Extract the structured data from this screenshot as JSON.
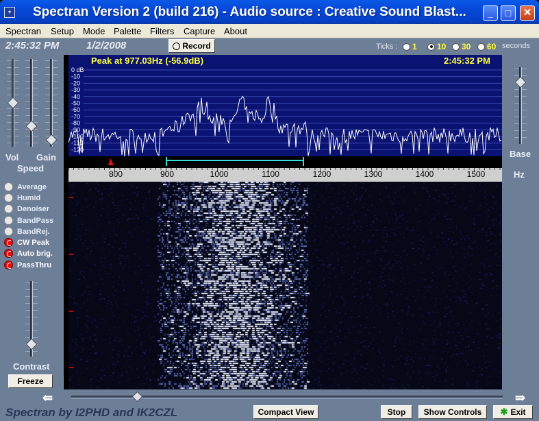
{
  "window": {
    "title": "Spectran Version 2 (build 216) - Audio source  :  Creative Sound Blast...",
    "controls": {
      "minimize": "_",
      "maximize": "□",
      "close": "✕"
    }
  },
  "menu": [
    "Spectran",
    "Setup",
    "Mode",
    "Palette",
    "Filters",
    "Capture",
    "About"
  ],
  "status": {
    "time": "2:45:32 PM",
    "date": "1/2/2008"
  },
  "record_label": "Record",
  "ticks": {
    "label": "Ticks :",
    "options": [
      "1",
      "10",
      "30",
      "60"
    ],
    "selected": "10",
    "unit": "seconds"
  },
  "sliders": {
    "vol": "Vol",
    "gain": "Gain",
    "speed": "Speed",
    "contrast": "Contrast",
    "base": "Base",
    "hz": "Hz"
  },
  "scope": {
    "peak_text": "Peak at   977.03Hz (-56.9dB)",
    "clock": "2:45:32 PM",
    "db_labels": [
      "0 dB",
      "-10",
      "-20",
      "-30",
      "-40",
      "-50",
      "-60",
      "-70",
      "-80",
      "-90",
      "-100",
      "-110",
      "-120"
    ]
  },
  "freq_axis": {
    "labels": [
      "800",
      "900",
      "1000",
      "1100",
      "1200",
      "1300",
      "1400",
      "1500"
    ]
  },
  "options": [
    {
      "label": "Average",
      "on": false
    },
    {
      "label": "Humid",
      "on": false
    },
    {
      "label": "Denoiser",
      "on": false
    },
    {
      "label": "BandPass",
      "on": false
    },
    {
      "label": "BandRej.",
      "on": false
    },
    {
      "label": "CW Peak",
      "on": true
    },
    {
      "label": "Auto brig.",
      "on": true
    },
    {
      "label": "PassThru",
      "on": true
    }
  ],
  "buttons": {
    "freeze": "Freeze",
    "compact": "Compact View",
    "stop": "Stop",
    "show_controls": "Show Controls",
    "exit": "Exit"
  },
  "footer": "Spectran  by I2PHD and IK2CZL",
  "colors": {
    "title_bar": "#0648d8",
    "scope_bg": "#0a1272",
    "waterfall_bg": "#060818",
    "body_bg": "#6d7e97",
    "accent_yellow": "#ffff40"
  }
}
